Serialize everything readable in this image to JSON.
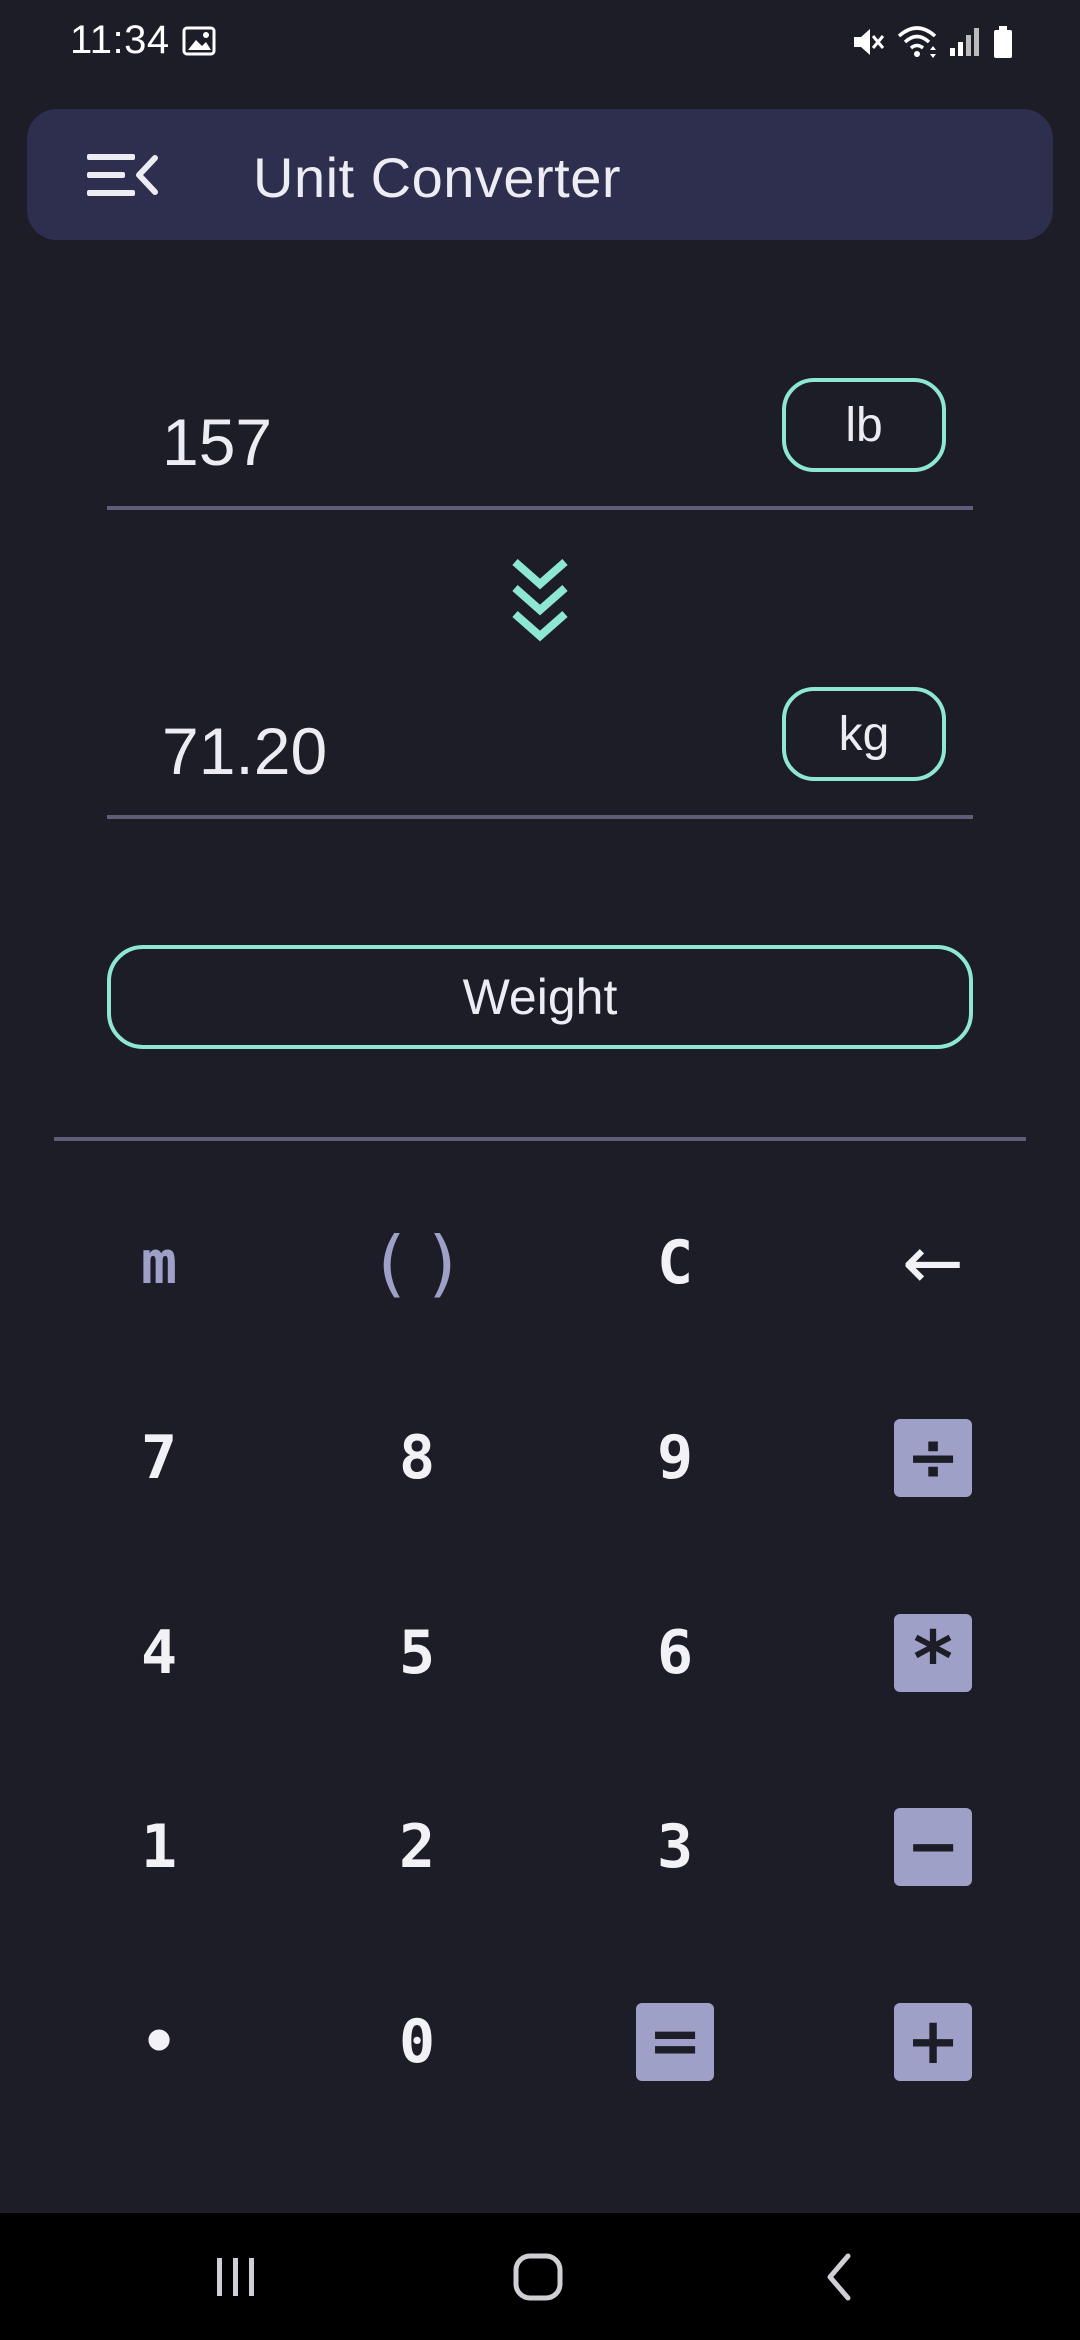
{
  "status_bar": {
    "time": "11:34",
    "icons": [
      "gallery-icon",
      "mute-icon",
      "wifi-icon",
      "signal-icon",
      "battery-icon"
    ]
  },
  "app_bar": {
    "title": "Unit Converter",
    "menu_icon": "menu-collapse-icon"
  },
  "converter": {
    "input_value": "157",
    "input_unit": "lb",
    "output_value": "71.20",
    "output_unit": "kg",
    "arrow_icon": "double-chevron-down-icon",
    "category": "Weight"
  },
  "keypad": {
    "rows": [
      [
        "m",
        "( )",
        "C",
        "←"
      ],
      [
        "7",
        "8",
        "9",
        "÷"
      ],
      [
        "4",
        "5",
        "6",
        "*"
      ],
      [
        "1",
        "2",
        "3",
        "−"
      ],
      [
        "•",
        "0",
        "=",
        "+"
      ]
    ]
  },
  "nav_bar": {
    "icons": [
      "recent-apps-icon",
      "home-icon",
      "back-icon"
    ]
  },
  "colors": {
    "background": "#1d1d27",
    "app_bar": "#2e2f4f",
    "accent": "#8ee7d3",
    "operator": "#9fa0c8",
    "divider": "#5e5e7a"
  }
}
